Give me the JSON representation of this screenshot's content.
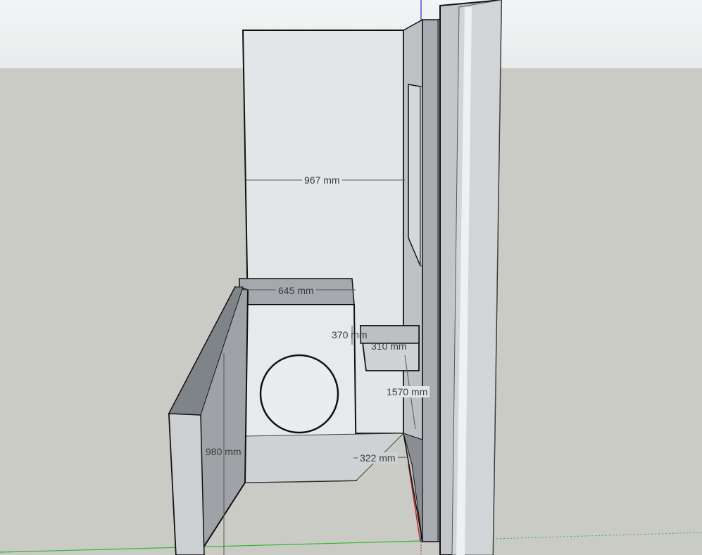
{
  "viewport": {
    "sky_color": "#eef0f1",
    "ground_color": "#cbcbc6"
  },
  "model": {
    "objects": [
      "back-wall",
      "side-wall-panel",
      "washing-machine",
      "machine-door",
      "shelf-box",
      "window-opening",
      "tall-partition",
      "floor-area"
    ],
    "axes": {
      "red": "#d04a4a",
      "green": "#2db82d",
      "blue": "#2b2bd8"
    }
  },
  "dimensions": {
    "wall_width": "967 mm",
    "machine_width": "645 mm",
    "shelf_height": "370 mm",
    "shelf_depth": "310 mm",
    "shelf_elevation": "1570 mm",
    "floor_gap": "322 mm",
    "panel_height": "980 mm"
  }
}
